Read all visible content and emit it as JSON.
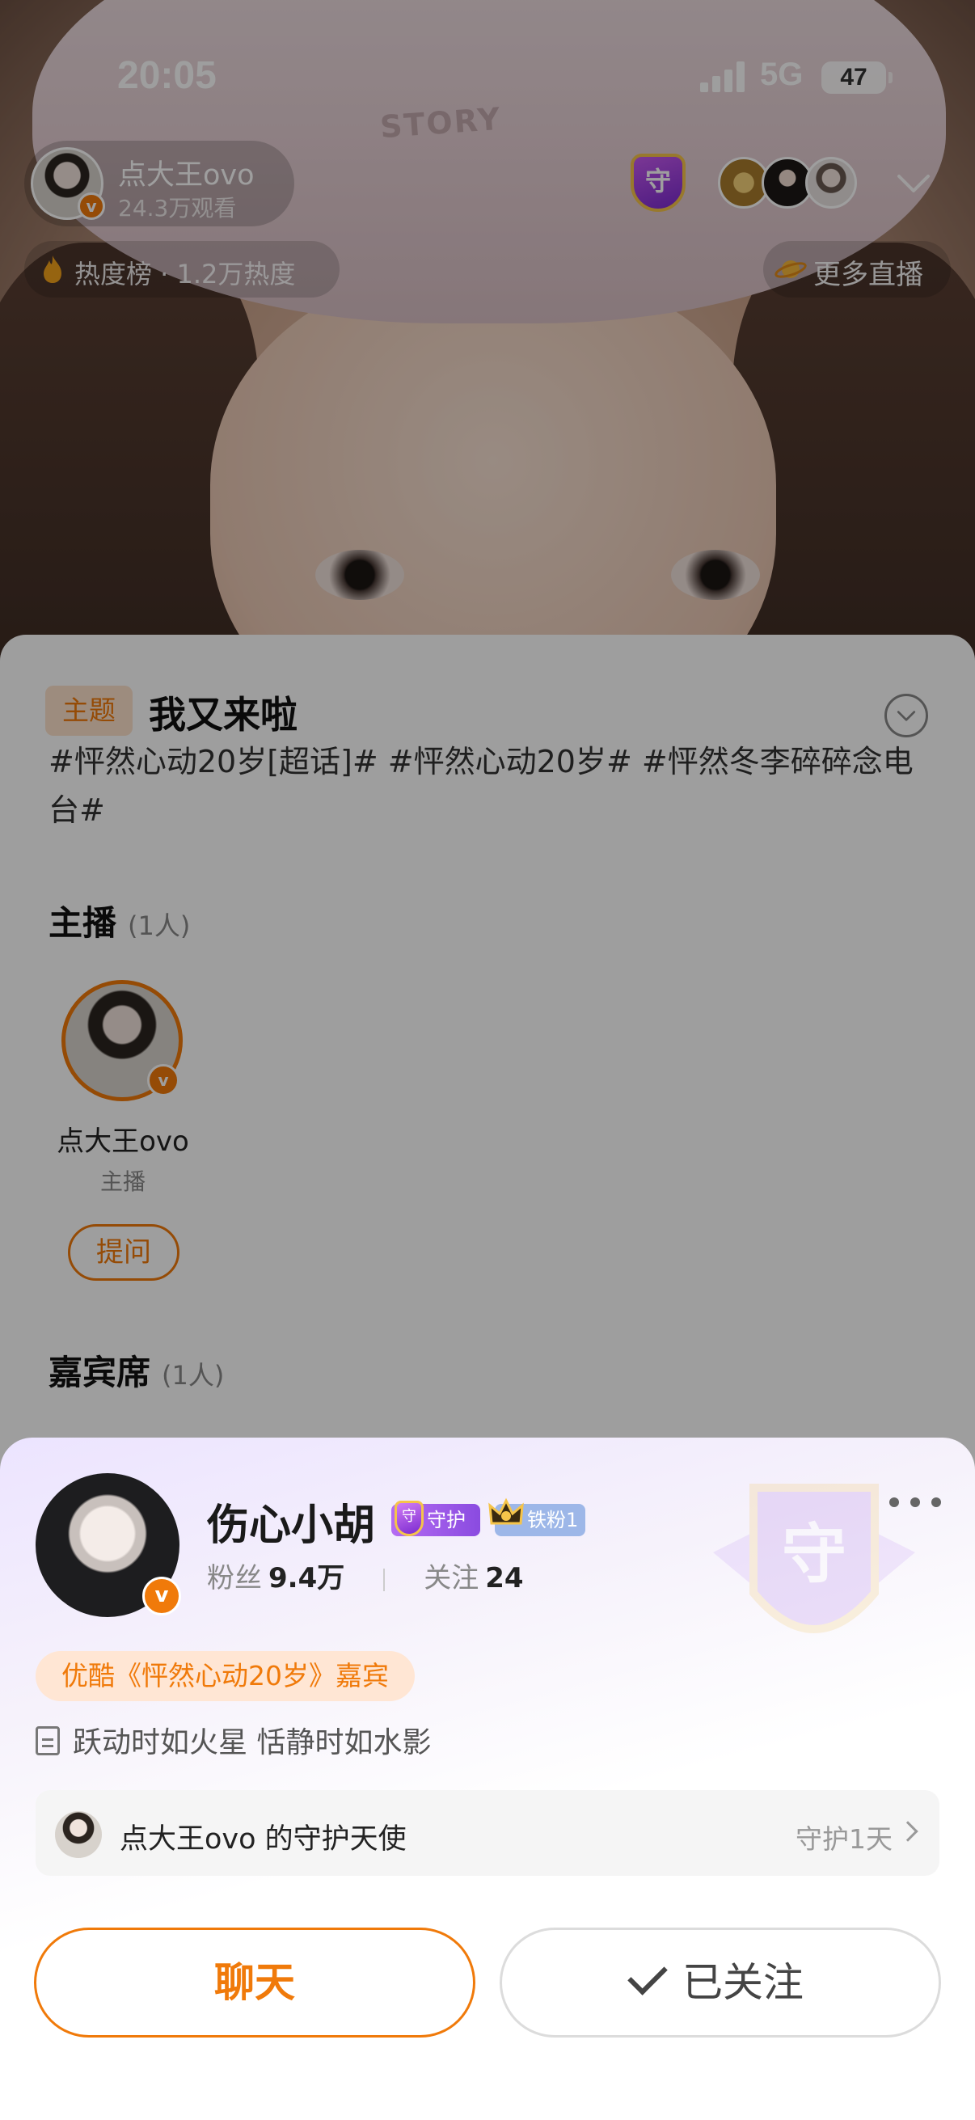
{
  "status_bar": {
    "time": "20:05",
    "network": "5G",
    "battery": "47"
  },
  "host": {
    "name": "点大王ovo",
    "views": "24.3万观看",
    "verified_badge": "v"
  },
  "guards": {
    "shield_label": "守"
  },
  "heat": {
    "label": "热度榜 · 1.2万热度"
  },
  "more_live": {
    "label": "更多直播"
  },
  "background_photo": {
    "hat_text": "STORY"
  },
  "topic": {
    "tag": "主题",
    "title": "我又来啦",
    "hashtags": "#怦然心动20岁[超话]# #怦然心动20岁# #怦然冬李碎碎念电台#"
  },
  "anchors": {
    "title": "主播",
    "count": "(1人)",
    "name": "点大王ovo",
    "role": "主播",
    "ask_button": "提问"
  },
  "guests": {
    "title": "嘉宾席",
    "count": "(1人)"
  },
  "profile": {
    "name": "伤心小胡",
    "badge_guard": "守护",
    "badge_guard_icon": "守",
    "badge_iron": "铁粉1",
    "fans_label": "粉丝",
    "fans_value": "9.4万",
    "follow_label": "关注",
    "follow_value": "24",
    "youku_tag": "优酷《怦然心动20岁》嘉宾",
    "bio": "跃动时如火星 恬静时如水影",
    "guard_row_text": "点大王ovo 的守护天使",
    "guard_row_days": "守护1天",
    "chat_button": "聊天",
    "followed_button": "已关注",
    "verified_badge": "v"
  },
  "colors": {
    "accent": "#f07a0a",
    "guard_purple": "#8a4be0",
    "iron_blue": "#9db7e8"
  }
}
